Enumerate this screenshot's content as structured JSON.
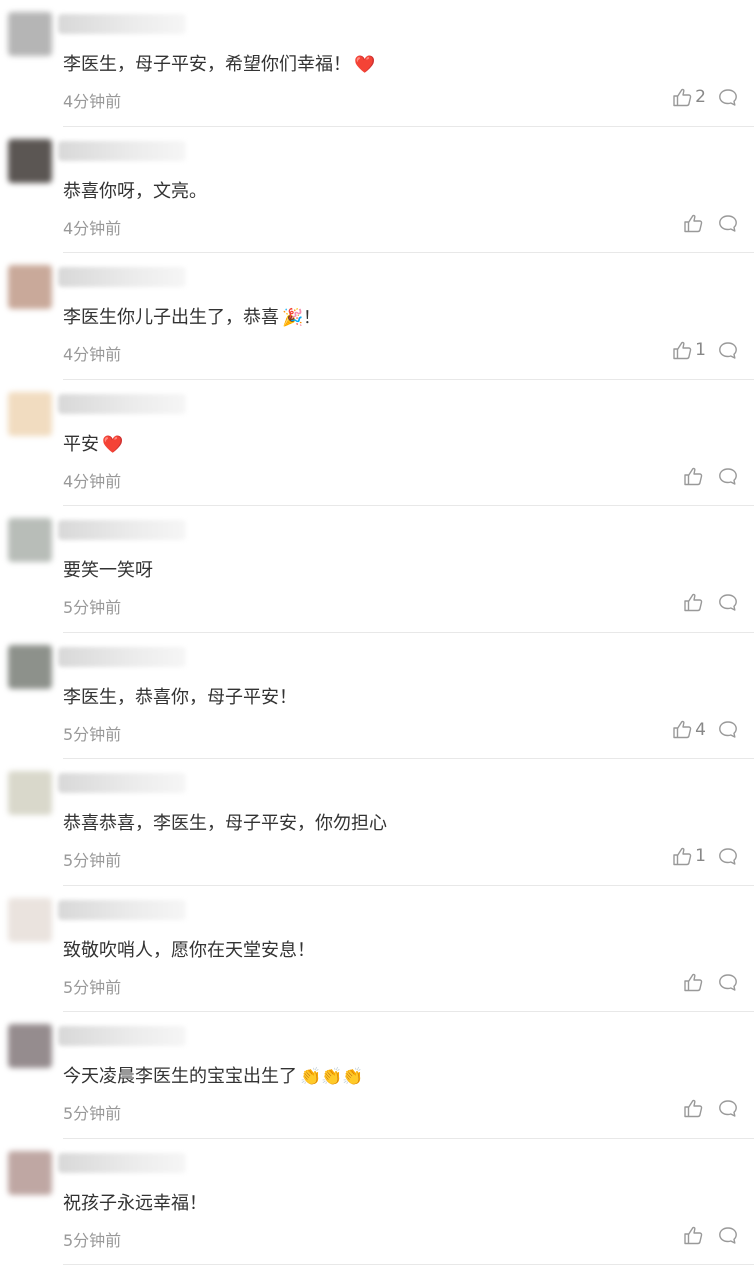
{
  "comments": [
    {
      "text": "李医生，母子平安，希望你们幸福！",
      "emoji": "❤️",
      "time": "4分钟前",
      "likes": "2",
      "avatar_color": "#b5b5b5"
    },
    {
      "text": "恭喜你呀，文亮。",
      "emoji": "",
      "time": "4分钟前",
      "likes": "",
      "avatar_color": "#5b5653"
    },
    {
      "text": "李医生你儿子出生了，恭喜",
      "emoji": "🎉！",
      "time": "4分钟前",
      "likes": "1",
      "avatar_color": "#c9a99a"
    },
    {
      "text": "平安",
      "emoji": "❤️",
      "time": "4分钟前",
      "likes": "",
      "avatar_color": "#f1dcc0"
    },
    {
      "text": "要笑一笑呀",
      "emoji": "",
      "time": "5分钟前",
      "likes": "",
      "avatar_color": "#b8bdb8"
    },
    {
      "text": "李医生，恭喜你，母子平安！",
      "emoji": "",
      "time": "5分钟前",
      "likes": "4",
      "avatar_color": "#8d918b"
    },
    {
      "text": "恭喜恭喜，李医生，母子平安，你勿担心",
      "emoji": "",
      "time": "5分钟前",
      "likes": "1",
      "avatar_color": "#d9d8cb"
    },
    {
      "text": "致敬吹哨人，愿你在天堂安息！",
      "emoji": "",
      "time": "5分钟前",
      "likes": "",
      "avatar_color": "#eae3de"
    },
    {
      "text": "今天凌晨李医生的宝宝出生了",
      "emoji": "👏👏👏",
      "time": "5分钟前",
      "likes": "",
      "avatar_color": "#958c8e"
    },
    {
      "text": "祝孩子永远幸福！",
      "emoji": "",
      "time": "5分钟前",
      "likes": "",
      "avatar_color": "#bfa7a3"
    }
  ],
  "icons": {
    "like": "thumbs-up-icon",
    "reply": "comment-bubble-icon"
  }
}
